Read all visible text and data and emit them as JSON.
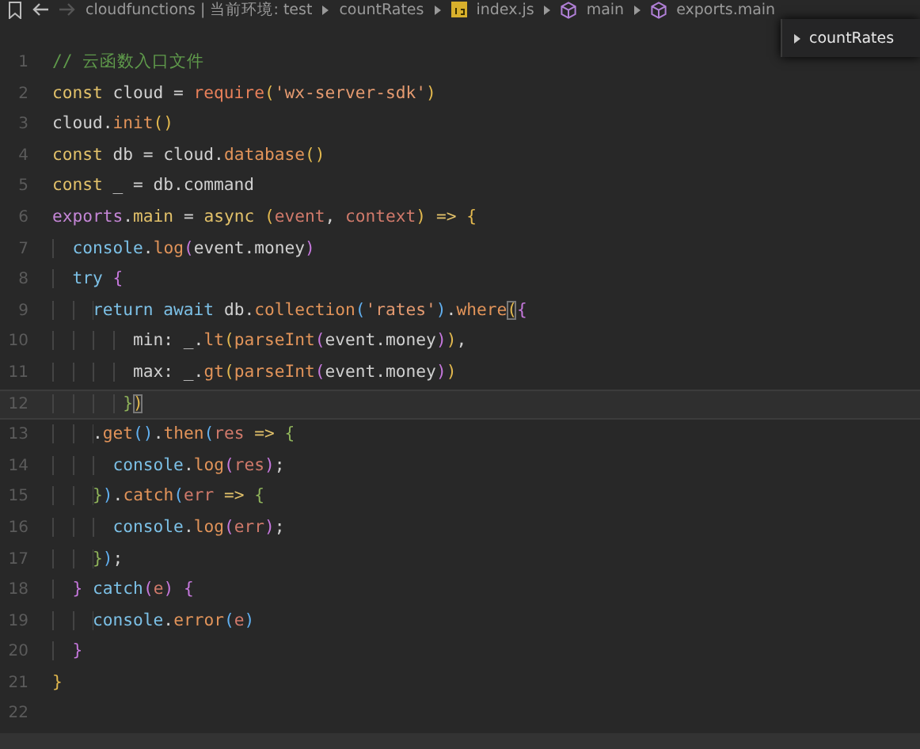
{
  "breadcrumb": {
    "nav": [
      {
        "kind": "bookmark",
        "disabled": false
      },
      {
        "kind": "back",
        "disabled": false
      },
      {
        "kind": "forward",
        "disabled": true
      }
    ],
    "items": [
      {
        "text": "cloudfunctions | 当前环境: test",
        "kind": "folder"
      },
      {
        "text": "countRates",
        "kind": "folder"
      },
      {
        "text": "index.js",
        "kind": "js"
      },
      {
        "text": "main",
        "kind": "symbol"
      },
      {
        "text": "exports.main",
        "kind": "symbol"
      }
    ]
  },
  "outline_popup": {
    "text": "countRates"
  },
  "editor": {
    "lines": [
      {
        "number": "1",
        "selected": false,
        "tokens": [
          {
            "text": "// 云函数入口文件",
            "kind": "comment"
          }
        ]
      },
      {
        "number": "2",
        "selected": false,
        "tokens": [
          {
            "text": "const",
            "kind": "storage"
          },
          {
            "text": " cloud = ",
            "kind": "plain"
          },
          {
            "text": "require",
            "kind": "require"
          },
          {
            "text": "(",
            "kind": "b1"
          },
          {
            "text": "'wx-server-sdk'",
            "kind": "string"
          },
          {
            "text": ")",
            "kind": "b1"
          }
        ]
      },
      {
        "number": "3",
        "selected": false,
        "tokens": [
          {
            "text": "cloud.",
            "kind": "plain"
          },
          {
            "text": "init",
            "kind": "method"
          },
          {
            "text": "()",
            "kind": "b1"
          }
        ]
      },
      {
        "number": "4",
        "selected": false,
        "tokens": [
          {
            "text": "const",
            "kind": "storage"
          },
          {
            "text": " db = cloud.",
            "kind": "plain"
          },
          {
            "text": "database",
            "kind": "method"
          },
          {
            "text": "()",
            "kind": "b1"
          }
        ]
      },
      {
        "number": "5",
        "selected": false,
        "tokens": [
          {
            "text": "const",
            "kind": "storage"
          },
          {
            "text": " _ = db.command",
            "kind": "plain"
          }
        ]
      },
      {
        "number": "6",
        "selected": false,
        "tokens": [
          {
            "text": "exports",
            "kind": "module"
          },
          {
            "text": ".",
            "kind": "plain"
          },
          {
            "text": "main",
            "kind": "storage"
          },
          {
            "text": " = ",
            "kind": "plain"
          },
          {
            "text": "async",
            "kind": "storage"
          },
          {
            "text": " (",
            "kind": "b1"
          },
          {
            "text": "event",
            "kind": "param"
          },
          {
            "text": ", ",
            "kind": "plain"
          },
          {
            "text": "context",
            "kind": "param"
          },
          {
            "text": ")",
            "kind": "b1"
          },
          {
            "text": " =>",
            "kind": "storage"
          },
          {
            "text": " {",
            "kind": "b1"
          }
        ]
      },
      {
        "number": "7",
        "selected": false,
        "tokens": [
          {
            "text": "  console",
            "kind": "builtin"
          },
          {
            "text": ".",
            "kind": "plain"
          },
          {
            "text": "log",
            "kind": "method"
          },
          {
            "text": "(",
            "kind": "b2"
          },
          {
            "text": "event.money",
            "kind": "plain"
          },
          {
            "text": ")",
            "kind": "b2"
          }
        ]
      },
      {
        "number": "8",
        "selected": false,
        "tokens": [
          {
            "text": "  try",
            "kind": "control"
          },
          {
            "text": " {",
            "kind": "b2"
          }
        ]
      },
      {
        "number": "9",
        "selected": false,
        "tokens": [
          {
            "text": "    return await",
            "kind": "control"
          },
          {
            "text": " db.",
            "kind": "plain"
          },
          {
            "text": "collection",
            "kind": "method"
          },
          {
            "text": "(",
            "kind": "b3"
          },
          {
            "text": "'rates'",
            "kind": "string"
          },
          {
            "text": ")",
            "kind": "b3"
          },
          {
            "text": ".",
            "kind": "plain"
          },
          {
            "text": "where",
            "kind": "method"
          },
          {
            "text": "(",
            "kind": "match"
          },
          {
            "text": "{",
            "kind": "b2"
          }
        ]
      },
      {
        "number": "10",
        "selected": false,
        "tokens": [
          {
            "text": "        min: _.",
            "kind": "plain"
          },
          {
            "text": "lt",
            "kind": "method"
          },
          {
            "text": "(",
            "kind": "b1"
          },
          {
            "text": "parseInt",
            "kind": "method"
          },
          {
            "text": "(",
            "kind": "b2"
          },
          {
            "text": "event.money",
            "kind": "plain"
          },
          {
            "text": ")",
            "kind": "b2"
          },
          {
            "text": ")",
            "kind": "b1"
          },
          {
            "text": ",",
            "kind": "plain"
          }
        ]
      },
      {
        "number": "11",
        "selected": false,
        "tokens": [
          {
            "text": "        max: _.",
            "kind": "plain"
          },
          {
            "text": "gt",
            "kind": "method"
          },
          {
            "text": "(",
            "kind": "b1"
          },
          {
            "text": "parseInt",
            "kind": "method"
          },
          {
            "text": "(",
            "kind": "b2"
          },
          {
            "text": "event.money",
            "kind": "plain"
          },
          {
            "text": ")",
            "kind": "b2"
          },
          {
            "text": ")",
            "kind": "b1"
          }
        ]
      },
      {
        "number": "12",
        "selected": true,
        "tokens": [
          {
            "text": "       }",
            "kind": "b4"
          },
          {
            "text": ")",
            "kind": "match"
          }
        ]
      },
      {
        "number": "13",
        "selected": false,
        "tokens": [
          {
            "text": "    .",
            "kind": "plain"
          },
          {
            "text": "get",
            "kind": "method"
          },
          {
            "text": "()",
            "kind": "b3"
          },
          {
            "text": ".",
            "kind": "plain"
          },
          {
            "text": "then",
            "kind": "method"
          },
          {
            "text": "(",
            "kind": "b3"
          },
          {
            "text": "res",
            "kind": "param"
          },
          {
            "text": " =>",
            "kind": "storage"
          },
          {
            "text": " {",
            "kind": "b4"
          }
        ]
      },
      {
        "number": "14",
        "selected": false,
        "tokens": [
          {
            "text": "      console",
            "kind": "builtin"
          },
          {
            "text": ".",
            "kind": "plain"
          },
          {
            "text": "log",
            "kind": "method"
          },
          {
            "text": "(",
            "kind": "b2"
          },
          {
            "text": "res",
            "kind": "param"
          },
          {
            "text": ")",
            "kind": "b2"
          },
          {
            "text": ";",
            "kind": "plain"
          }
        ]
      },
      {
        "number": "15",
        "selected": false,
        "tokens": [
          {
            "text": "    }",
            "kind": "b4"
          },
          {
            "text": ")",
            "kind": "b3"
          },
          {
            "text": ".",
            "kind": "plain"
          },
          {
            "text": "catch",
            "kind": "method"
          },
          {
            "text": "(",
            "kind": "b3"
          },
          {
            "text": "err",
            "kind": "param"
          },
          {
            "text": " =>",
            "kind": "storage"
          },
          {
            "text": " {",
            "kind": "b4"
          }
        ]
      },
      {
        "number": "16",
        "selected": false,
        "tokens": [
          {
            "text": "      console",
            "kind": "builtin"
          },
          {
            "text": ".",
            "kind": "plain"
          },
          {
            "text": "log",
            "kind": "method"
          },
          {
            "text": "(",
            "kind": "b2"
          },
          {
            "text": "err",
            "kind": "param"
          },
          {
            "text": ")",
            "kind": "b2"
          },
          {
            "text": ";",
            "kind": "plain"
          }
        ]
      },
      {
        "number": "17",
        "selected": false,
        "tokens": [
          {
            "text": "    }",
            "kind": "b4"
          },
          {
            "text": ")",
            "kind": "b3"
          },
          {
            "text": ";",
            "kind": "plain"
          }
        ]
      },
      {
        "number": "18",
        "selected": false,
        "tokens": [
          {
            "text": "  }",
            "kind": "b2"
          },
          {
            "text": " catch",
            "kind": "control"
          },
          {
            "text": "(",
            "kind": "b2"
          },
          {
            "text": "e",
            "kind": "param"
          },
          {
            "text": ")",
            "kind": "b2"
          },
          {
            "text": " {",
            "kind": "b2"
          }
        ]
      },
      {
        "number": "19",
        "selected": false,
        "tokens": [
          {
            "text": "    console",
            "kind": "builtin"
          },
          {
            "text": ".",
            "kind": "plain"
          },
          {
            "text": "error",
            "kind": "method"
          },
          {
            "text": "(",
            "kind": "b3"
          },
          {
            "text": "e",
            "kind": "param"
          },
          {
            "text": ")",
            "kind": "b3"
          }
        ]
      },
      {
        "number": "20",
        "selected": false,
        "tokens": [
          {
            "text": "  }",
            "kind": "b2"
          }
        ]
      },
      {
        "number": "21",
        "selected": false,
        "tokens": [
          {
            "text": "}",
            "kind": "b1"
          }
        ]
      },
      {
        "number": "22",
        "selected": false
      }
    ]
  }
}
